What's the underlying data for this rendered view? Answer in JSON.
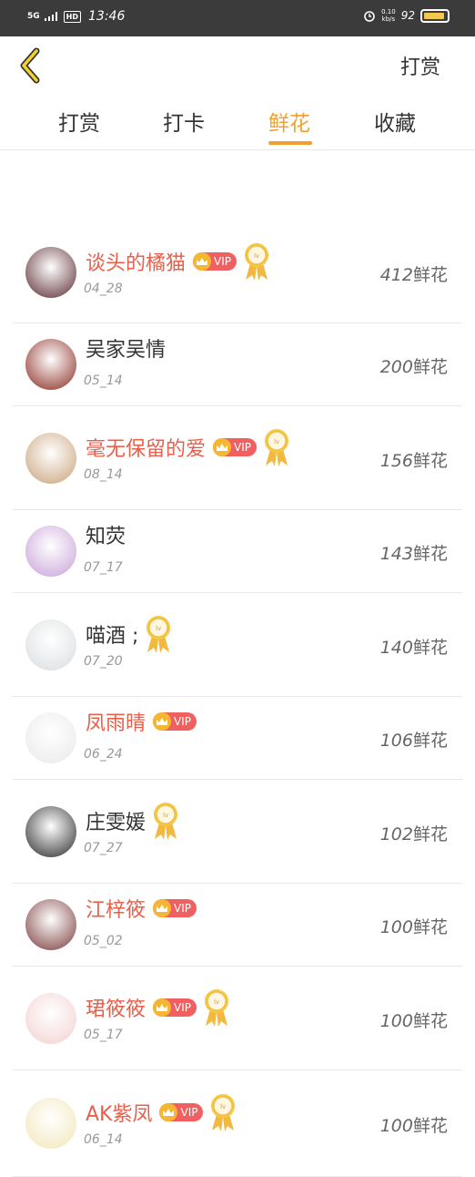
{
  "status_bar": {
    "network": "5G",
    "hd": "HD",
    "time": "13:46",
    "speed_value": "0.10",
    "speed_unit": "kb/s",
    "battery": "92",
    "battery_level": 0.92
  },
  "header": {
    "back_icon": "chevron-left-icon",
    "action_label": "打赏"
  },
  "tabs": [
    {
      "label": "打赏",
      "active": false
    },
    {
      "label": "打卡",
      "active": false
    },
    {
      "label": "鲜花",
      "active": true
    },
    {
      "label": "收藏",
      "active": false
    }
  ],
  "vip_label": "VIP",
  "list": [
    {
      "name": "谈头的橘猫",
      "vip": true,
      "medal": true,
      "date": "04_28",
      "count": "412",
      "unit": "鲜花",
      "avatar_color": "#5a2a30"
    },
    {
      "name": "吴家吴情",
      "vip": false,
      "medal": false,
      "date": "05_14",
      "count": "200",
      "unit": "鲜花",
      "avatar_color": "#8b2a20"
    },
    {
      "name": "毫无保留的爱",
      "vip": true,
      "medal": true,
      "date": "08_14",
      "count": "156",
      "unit": "鲜花",
      "avatar_color": "#c9a27a"
    },
    {
      "name": "知荧",
      "vip": false,
      "medal": false,
      "date": "07_17",
      "count": "143",
      "unit": "鲜花",
      "avatar_color": "#c7a0d8"
    },
    {
      "name": "喵酒 ;",
      "vip": false,
      "medal": true,
      "date": "07_20",
      "count": "140",
      "unit": "鲜花",
      "avatar_color": "#d8dde0"
    },
    {
      "name": "凤雨晴",
      "vip": true,
      "medal": false,
      "date": "06_24",
      "count": "106",
      "unit": "鲜花",
      "avatar_color": "#e9e9e9"
    },
    {
      "name": "庄雯媛",
      "vip": false,
      "medal": true,
      "date": "07_27",
      "count": "102",
      "unit": "鲜花",
      "avatar_color": "#2a2a2a"
    },
    {
      "name": "江梓筱",
      "vip": true,
      "medal": false,
      "date": "05_02",
      "count": "100",
      "unit": "鲜花",
      "avatar_color": "#7a3a3a"
    },
    {
      "name": "珺筱筱",
      "vip": true,
      "medal": true,
      "date": "05_17",
      "count": "100",
      "unit": "鲜花",
      "avatar_color": "#f4d0d0"
    },
    {
      "name": "AK紫凤",
      "vip": true,
      "medal": true,
      "date": "06_14",
      "count": "100",
      "unit": "鲜花",
      "avatar_color": "#f2e6b8"
    }
  ],
  "colors": {
    "accent": "#f0a030",
    "vip_name": "#e8604c",
    "vip_badge": "#f06060"
  }
}
